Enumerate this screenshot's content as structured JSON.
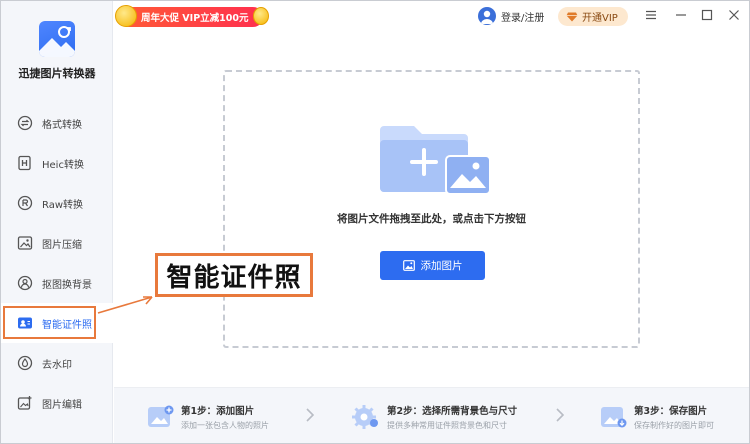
{
  "app": {
    "name": "迅捷图片转换器"
  },
  "promo": {
    "text": "周年大促 VIP立减100元"
  },
  "header": {
    "login_label": "登录/注册",
    "vip_label": "开通VIP"
  },
  "sidebar": {
    "items": [
      {
        "label": "格式转换",
        "icon": "format-convert-icon"
      },
      {
        "label": "Heic转换",
        "icon": "heic-icon"
      },
      {
        "label": "Raw转换",
        "icon": "raw-icon"
      },
      {
        "label": "图片压缩",
        "icon": "compress-icon"
      },
      {
        "label": "抠图换背景",
        "icon": "cutout-icon"
      },
      {
        "label": "智能证件照",
        "icon": "id-photo-icon"
      },
      {
        "label": "去水印",
        "icon": "watermark-icon"
      },
      {
        "label": "图片编辑",
        "icon": "edit-icon"
      }
    ],
    "active_index": 5
  },
  "main": {
    "drop_text": "将图片文件拖拽至此处，或点击下方按钮",
    "add_button": "添加图片"
  },
  "callout": {
    "text": "智能证件照"
  },
  "steps": [
    {
      "title": "第1步：添加图片",
      "sub": "添加一张包含人物的照片"
    },
    {
      "title": "第2步：选择所需背景色与尺寸",
      "sub": "提供多种常用证件照背景色和尺寸"
    },
    {
      "title": "第3步：保存图片",
      "sub": "保存制作好的图片即可"
    }
  ],
  "colors": {
    "accent": "#2d6cf0",
    "highlight": "#e8793c",
    "promo": "#ff3b45",
    "vip_bg": "#fde8cf"
  }
}
